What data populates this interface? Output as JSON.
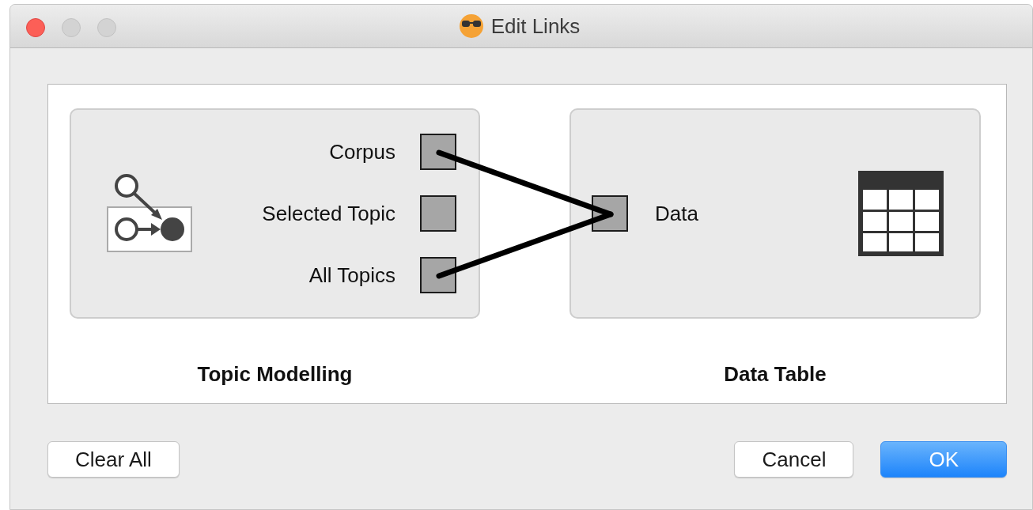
{
  "window": {
    "title": "Edit Links"
  },
  "source": {
    "name": "Topic Modelling",
    "outputs": [
      {
        "label": "Corpus",
        "linked": true
      },
      {
        "label": "Selected Topic",
        "linked": false
      },
      {
        "label": "All Topics",
        "linked": true
      }
    ]
  },
  "sink": {
    "name": "Data Table",
    "inputs": [
      {
        "label": "Data"
      }
    ]
  },
  "buttons": [
    {
      "label": "Clear All",
      "default": false
    },
    {
      "label": "Cancel",
      "default": false
    },
    {
      "label": "OK",
      "default": true
    }
  ]
}
